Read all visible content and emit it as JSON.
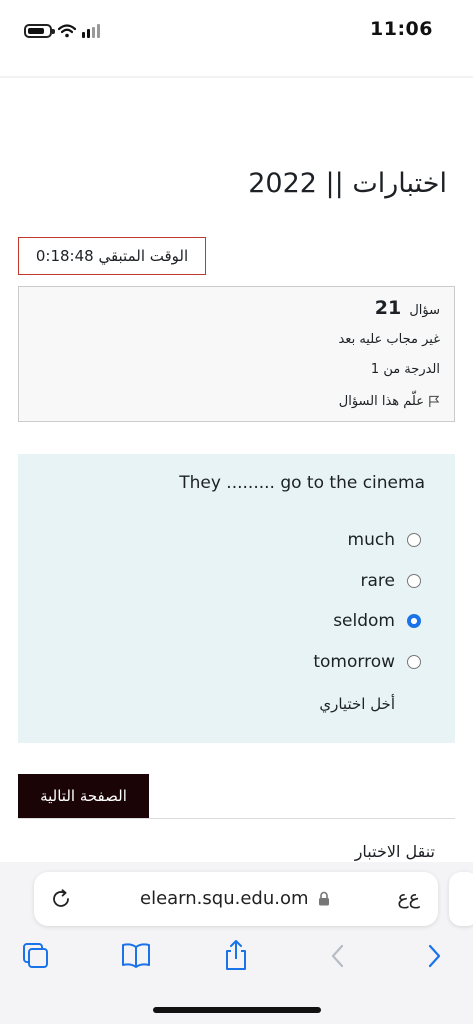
{
  "status_bar": {
    "time": "11:06"
  },
  "page": {
    "title": "اختبارات || 2022",
    "timer_label": "الوقت المتبقي 0:18:48"
  },
  "question_info": {
    "label": "سؤال",
    "number": "21",
    "status": "غير مجاب عليه بعد",
    "mark": "الدرجة من 1",
    "flag_label": "علّم هذا السؤال"
  },
  "question": {
    "text": "They ......... go to the cinema",
    "options": [
      {
        "label": "much",
        "selected": false
      },
      {
        "label": "rare",
        "selected": false
      },
      {
        "label": "seldom",
        "selected": true
      },
      {
        "label": "tomorrow",
        "selected": false
      }
    ],
    "clear_label": "أخل اختياري"
  },
  "navigation": {
    "next_button": "الصفحة التالية",
    "quiz_nav_label": "تنقل الاختبار"
  },
  "browser": {
    "url": "elearn.squ.edu.om",
    "text_size_label": "ﻉﻉ"
  },
  "colors": {
    "accent": "#1a73e8",
    "timer_border": "#c0392b",
    "next_button_bg": "#1a0406",
    "question_bg": "#e7f3f5",
    "info_bg": "#f7f8f7"
  }
}
